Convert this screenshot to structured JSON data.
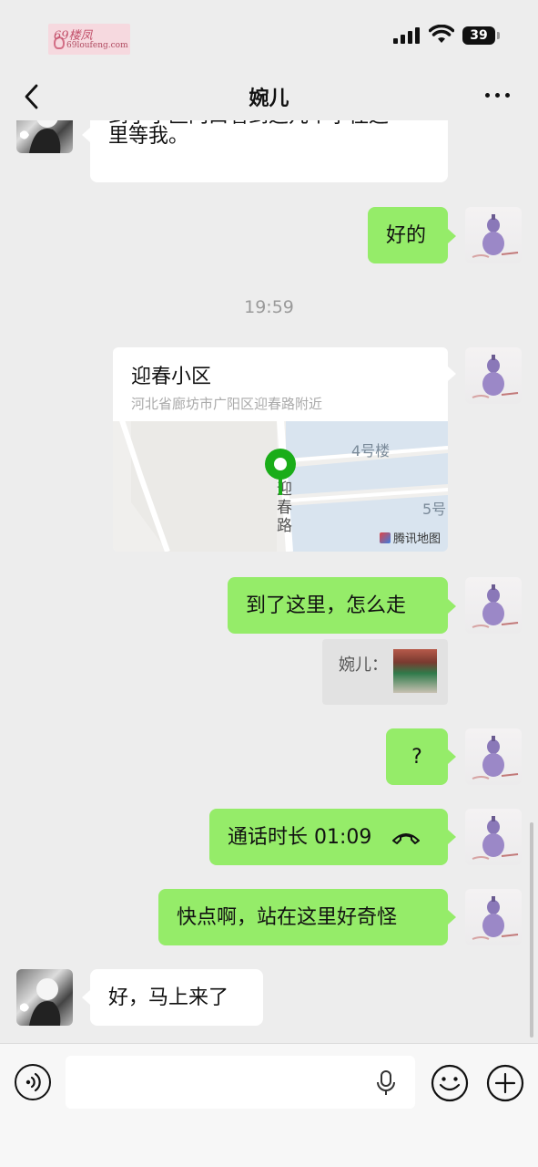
{
  "status_bar": {
    "watermark_top": "69楼凤",
    "watermark_bottom": "69loufeng.com",
    "battery": "39"
  },
  "header": {
    "title": "婉儿"
  },
  "messages": {
    "m1": {
      "sender": "other",
      "text_line1": "到了小区门口看到这几个字往这",
      "text_line2": "里等我。"
    },
    "m2": {
      "sender": "me",
      "text": "好的"
    },
    "timestamp": "19:59",
    "m3": {
      "sender": "me",
      "type": "location",
      "name": "迎春小区",
      "address": "河北省廊坊市广阳区迎春路附近",
      "map_labels": {
        "building4": "4号楼",
        "building5": "5号",
        "road": "迎春路",
        "credit": "腾讯地图"
      }
    },
    "m4": {
      "sender": "me",
      "text": "到了这里，怎么走"
    },
    "m4_quote": {
      "text": "婉儿："
    },
    "m5": {
      "sender": "me",
      "text": "?"
    },
    "m6": {
      "sender": "me",
      "type": "call",
      "text": "通话时长 01:09"
    },
    "m7": {
      "sender": "me",
      "text": "快点啊，站在这里好奇怪"
    },
    "m8": {
      "sender": "other",
      "text": "好，马上来了"
    }
  },
  "input_bar": {
    "placeholder": ""
  },
  "colors": {
    "sent_bubble": "#95ec69",
    "received_bubble": "#ffffff",
    "background": "#ededed",
    "map_pin": "#1aad19"
  }
}
